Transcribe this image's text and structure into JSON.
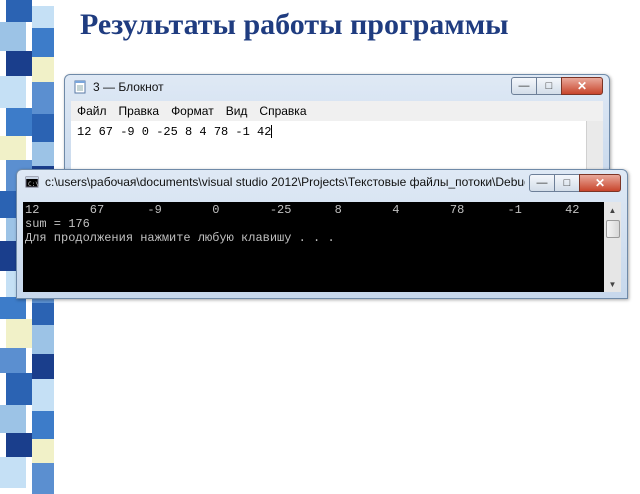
{
  "slide_title": "Результаты работы программы",
  "stripe_colors": [
    "#2b63b3",
    "#9cc3e6",
    "#1a3e8c",
    "#c5e0f5",
    "#3d7cc9",
    "#f1f1c8",
    "#5b8fd0"
  ],
  "notepad": {
    "title": "3 — Блокнот",
    "menu": [
      "Файл",
      "Правка",
      "Формат",
      "Вид",
      "Справка"
    ],
    "content": "12 67 -9 0 -25 8 4 78 -1 42",
    "icon": "notepad-icon"
  },
  "console": {
    "title": "c:\\users\\рабочая\\documents\\visual studio 2012\\Projects\\Текстовые файлы_потоки\\Debug\\Текст...",
    "lines": [
      "12       67      -9       0       -25      8       4       78      -1      42",
      "sum = 176",
      "Для продолжения нажмите любую клавишу . . ."
    ],
    "icon": "console-icon"
  },
  "window_controls": {
    "minimize": "minimize-icon",
    "maximize": "maximize-icon",
    "close": "close-icon"
  }
}
